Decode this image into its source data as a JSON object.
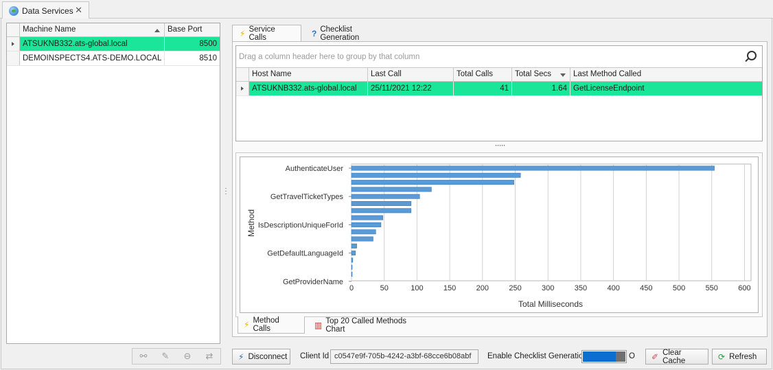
{
  "document_tab": {
    "title": "Data Services",
    "close": "✕"
  },
  "machines": {
    "columns": [
      "Machine Name",
      "Base Port"
    ],
    "rows": [
      {
        "name": "ATSUKNB332.ats-global.local",
        "port": "8500"
      },
      {
        "name": "DEMOINSPECTS4.ATS-DEMO.LOCAL",
        "port": "8510"
      }
    ]
  },
  "right_tabs": {
    "service_calls": "Service Calls",
    "checklist_generation": "Checklist Generation"
  },
  "service_grid": {
    "group_hint": "Drag a column header here to group by that column",
    "columns": [
      "Host Name",
      "Last Call",
      "Total Calls",
      "Total Secs",
      "Last Method Called"
    ],
    "rows": [
      {
        "host": "ATSUKNB332.ats-global.local",
        "last_call": "25/11/2021 12:22",
        "total_calls": "41",
        "total_secs": "1.64",
        "last_method": "GetLicenseEndpoint"
      }
    ]
  },
  "chart_data": {
    "type": "bar",
    "orientation": "horizontal",
    "ylabel": "Method",
    "xlabel": "Total Milliseconds",
    "xlim": [
      0,
      610
    ],
    "xticks": [
      0,
      50,
      100,
      150,
      200,
      250,
      300,
      350,
      400,
      450,
      500,
      550,
      600
    ],
    "category_labels": [
      "AuthenticateUser",
      "GetTravelTicketTypes",
      "IsDescriptionUniqueForId",
      "GetDefaultLanguageId",
      "GetProviderName"
    ],
    "values": [
      554,
      258,
      248,
      122,
      104,
      91,
      91,
      48,
      45,
      37,
      33,
      8,
      6,
      2,
      1,
      0.5
    ],
    "bar_color": "#5b9bd5",
    "grid": true
  },
  "bottom_tabs": {
    "method_calls": "Method Calls",
    "top20": "Top 20 Called Methods Chart"
  },
  "footer": {
    "disconnect": "Disconnect",
    "client_id_label": "Client Id",
    "client_id": "c0547e9f-705b-4242-a3bf-68cce6b08abf",
    "checklist_label": "Enable Checklist Generation",
    "toggle_state": "O",
    "clear_cache": "Clear Cache",
    "refresh": "Refresh"
  },
  "colors": {
    "selection": "#1ae598",
    "toggle_on": "#0a6fcf"
  }
}
